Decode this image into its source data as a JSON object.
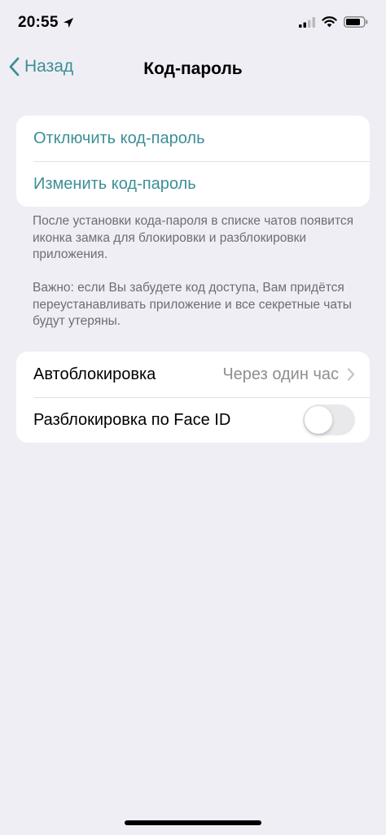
{
  "status_bar": {
    "time": "20:55",
    "icons": [
      "location-icon",
      "signal-icon",
      "wifi-icon",
      "battery-icon"
    ]
  },
  "nav": {
    "back_label": "Назад",
    "title": "Код-пароль"
  },
  "passcode_group": {
    "disable_label": "Отключить код-пароль",
    "change_label": "Изменить код-пароль"
  },
  "footer": {
    "info_text": "После установки кода-пароля в списке чатов появится иконка замка для блокировки и разблокировки приложения.",
    "warning_text": "Важно: если Вы забудете код доступа, Вам придётся переустанавливать приложение и все секретные чаты будут утеряны."
  },
  "settings_group": {
    "autolock_label": "Автоблокировка",
    "autolock_value": "Через один час",
    "faceid_label": "Разблокировка по Face ID",
    "faceid_enabled": false
  },
  "colors": {
    "accent": "#3d8f97",
    "background": "#efeef4",
    "secondary_text": "#8e8e93"
  }
}
